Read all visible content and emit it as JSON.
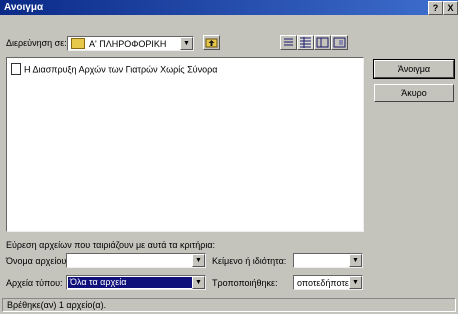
{
  "window": {
    "title": "Ανοιγμα",
    "help_label": "?",
    "close_label": "X"
  },
  "lookin": {
    "label": "Διερεύνηση σε:",
    "value": "Α' ΠΛΗΡΟΦΟΡΙΚΗ",
    "icon": "folder-icon"
  },
  "toolbar": {
    "up_icon": "folder-up-icon",
    "view_icons": [
      "list-view-icon",
      "details-view-icon",
      "properties-view-icon",
      "preview-view-icon"
    ]
  },
  "files": [
    {
      "name": "Η Διασπρυξη Αρχών των Γιατρών Χωρίς Σύνορα",
      "icon": "document-icon"
    }
  ],
  "buttons": {
    "open": "Άνοιγμα",
    "cancel": "Άκυρο"
  },
  "criteria": {
    "heading": "Εύρεση αρχείων που ταιριάζουν με αυτά τα κριτήρια:",
    "filename_label": "Όνομα αρχείου:",
    "filename_value": "",
    "filetype_label": "Αρχεία τύπου:",
    "filetype_value": "Όλα τα αρχεία",
    "text_label": "Κείμενο ή ιδιότητα:",
    "text_value": "",
    "modified_label": "Τροποποιήθηκε:",
    "modified_value": "οποτεδήποτε"
  },
  "status": {
    "text": "Βρέθηκε(αν) 1 αρχείο(α)."
  }
}
